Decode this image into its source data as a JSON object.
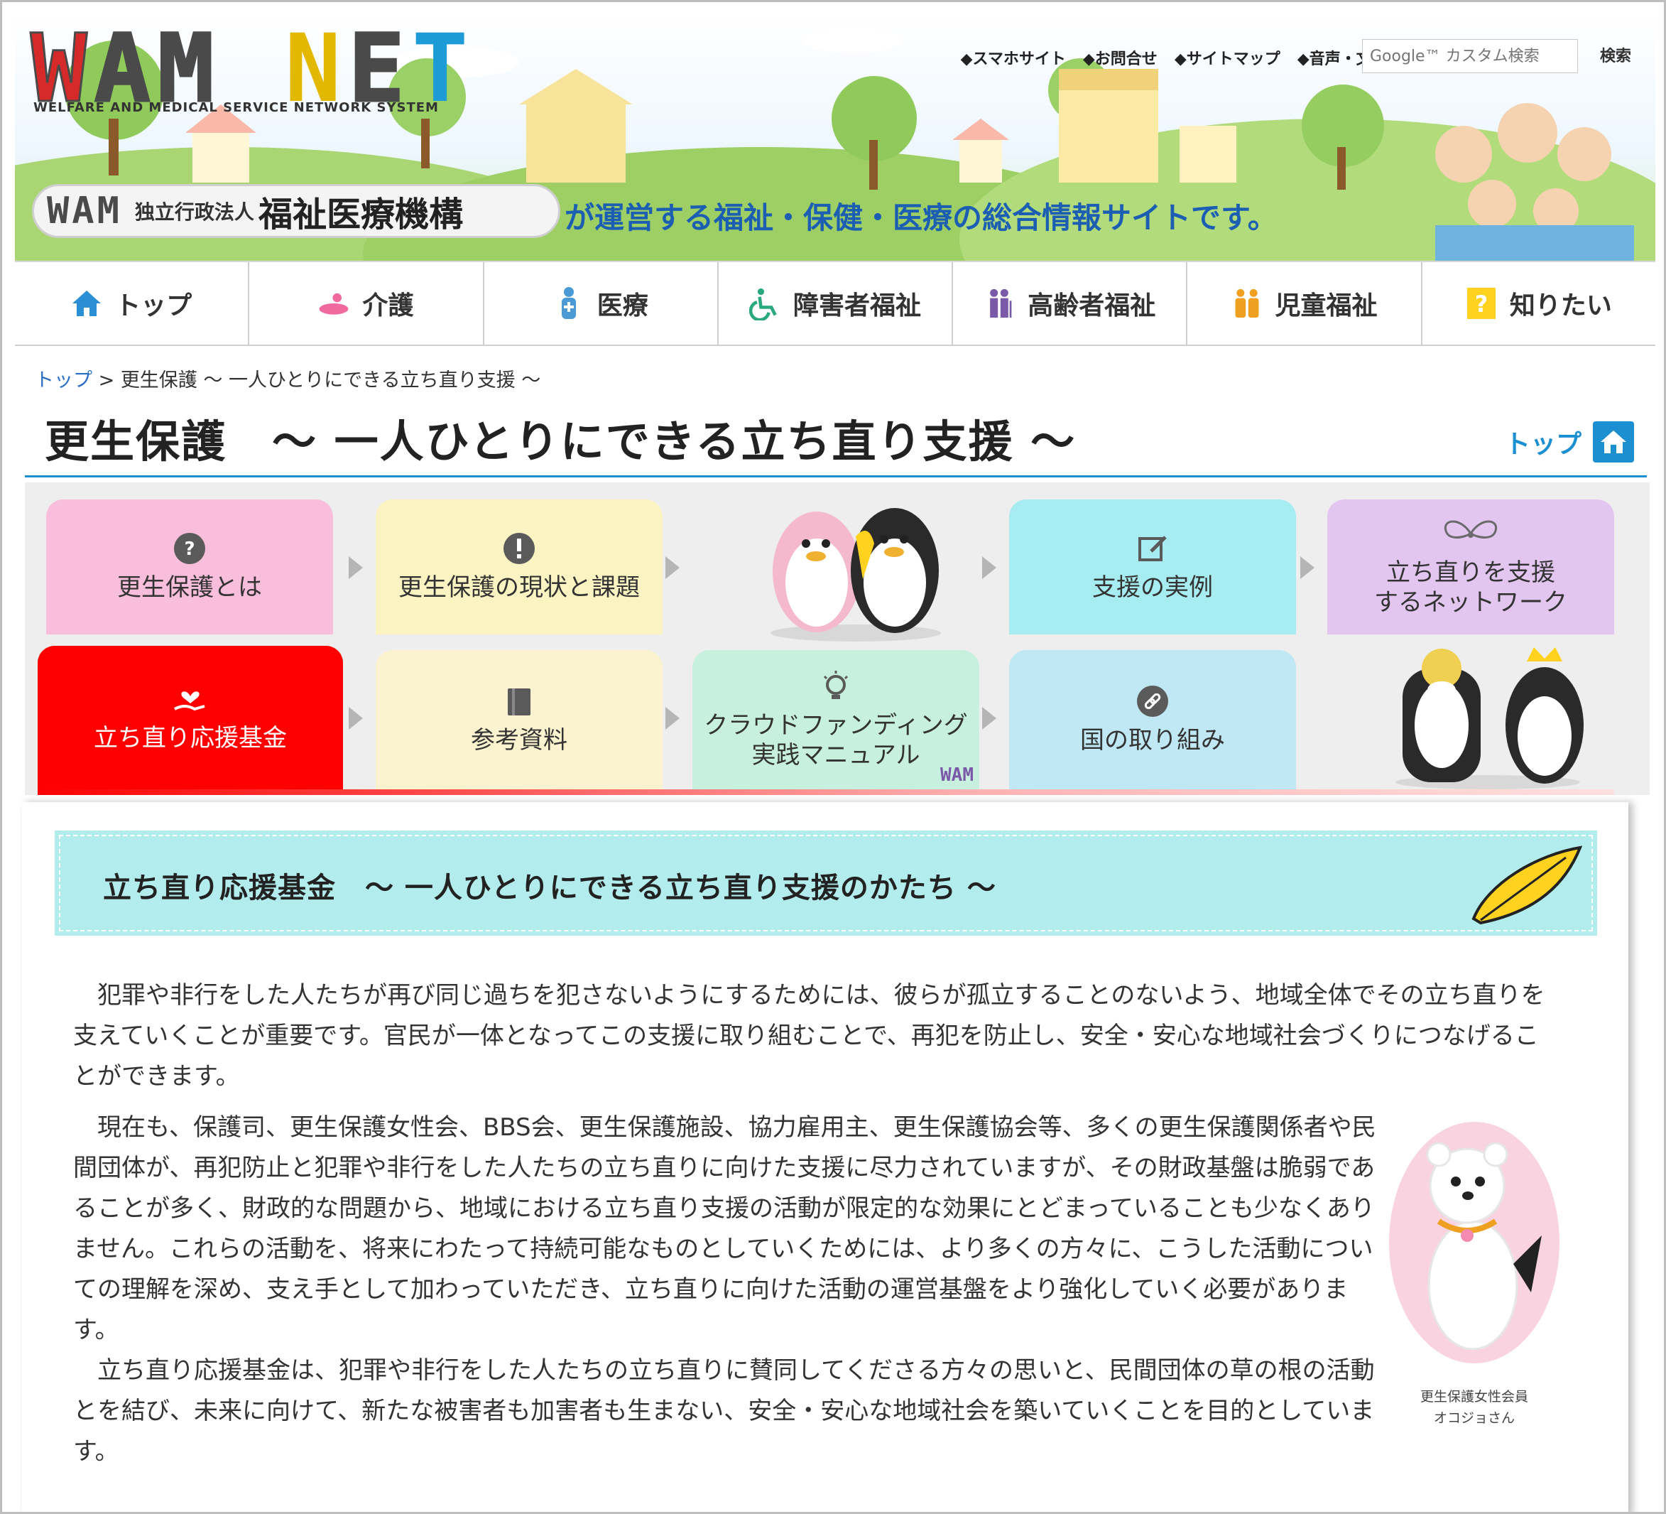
{
  "header": {
    "logo_main_a": "WAM",
    "logo_main_b": "NET",
    "logo_sub": "WELFARE AND MEDICAL SERVICE NETWORK SYSTEM",
    "top_links": [
      "◆スマホサイト",
      "◆お問合せ",
      "◆サイトマップ",
      "◆音声・文字サイズ"
    ],
    "search_placeholder": "Google™ カスタム検索",
    "search_button": "検索",
    "badge_logo": "WAM",
    "badge_org": "独立行政法人",
    "badge_name": "福祉医療機構",
    "tagline": "が運営する福祉・保健・医療の総合情報サイトです。"
  },
  "nav": {
    "items": [
      {
        "label": "トップ",
        "icon": "home-icon"
      },
      {
        "label": "介護",
        "icon": "care-icon"
      },
      {
        "label": "医療",
        "icon": "medical-icon"
      },
      {
        "label": "障害者福祉",
        "icon": "wheelchair-icon"
      },
      {
        "label": "高齢者福祉",
        "icon": "elderly-icon"
      },
      {
        "label": "児童福祉",
        "icon": "children-icon"
      },
      {
        "label": "知りたい",
        "icon": "question-icon"
      }
    ]
  },
  "breadcrumb": {
    "home": "トップ",
    "separator": ">",
    "parent": "更生保護",
    "current": "～ 一人ひとりにできる立ち直り支援 ～"
  },
  "page": {
    "title": "更生保護　～ 一人ひとりにできる立ち直り支援 ～",
    "top_link": "トップ"
  },
  "menu": {
    "row1": [
      "更生保護とは",
      "更生保護の現状と課題",
      "支援の実例",
      "立ち直りを支援するネットワーク"
    ],
    "row1_network_line1": "立ち直りを支援",
    "row1_network_line2": "するネットワーク",
    "row2": [
      "立ち直り応援基金",
      "参考資料",
      "国の取り組み"
    ],
    "crowd_line1": "クラウドファンディング",
    "crowd_line2": "実践マニュアル",
    "crowd_logo": "WAM"
  },
  "colors": {
    "pink": "#f9bedb",
    "yellow": "#fbf4c2",
    "cyan": "#a6ecf0",
    "purple": "#e3c6f0",
    "red": "#ff0000",
    "cream": "#fbf3cf",
    "mint": "#c7f0de",
    "lightblue": "#bfe8f4",
    "accent": "#1c8fd0"
  },
  "content": {
    "banner_title": "立ち直り応援基金　～ 一人ひとりにできる立ち直り支援のかたち ～",
    "p1": "犯罪や非行をした人たちが再び同じ過ちを犯さないようにするためには、彼らが孤立することのないよう、地域全体でその立ち直りを支えていくことが重要です。官民が一体となってこの支援に取り組むことで、再犯を防止し、安全・安心な地域社会づくりにつなげることができます。",
    "p2": "現在も、保護司、更生保護女性会、BBS会、更生保護施設、協力雇用主、更生保護協会等、多くの更生保護関係者や民間団体が、再犯防止と犯罪や非行をした人たちの立ち直りに向けた支援に尽力されていますが、その財政基盤は脆弱であることが多く、財政的な問題から、地域における立ち直り支援の活動が限定的な効果にとどまっていることも少なくありません。これらの活動を、将来にわたって持続可能なものとしていくためには、より多くの方々に、こうした活動についての理解を深め、支え手として加わっていただき、立ち直りに向けた活動の運営基盤をより強化していく必要があります。",
    "p3": "立ち直り応援基金は、犯罪や非行をした人たちの立ち直りに賛同してくださる方々の思いと、民間団体の草の根の活動とを結び、未来に向けて、新たな被害者も加害者も生まない、安全・安心な地域社会を築いていくことを目的としています。",
    "character_caption_1": "更生保護女性会員",
    "character_caption_2": "オコジョさん"
  }
}
